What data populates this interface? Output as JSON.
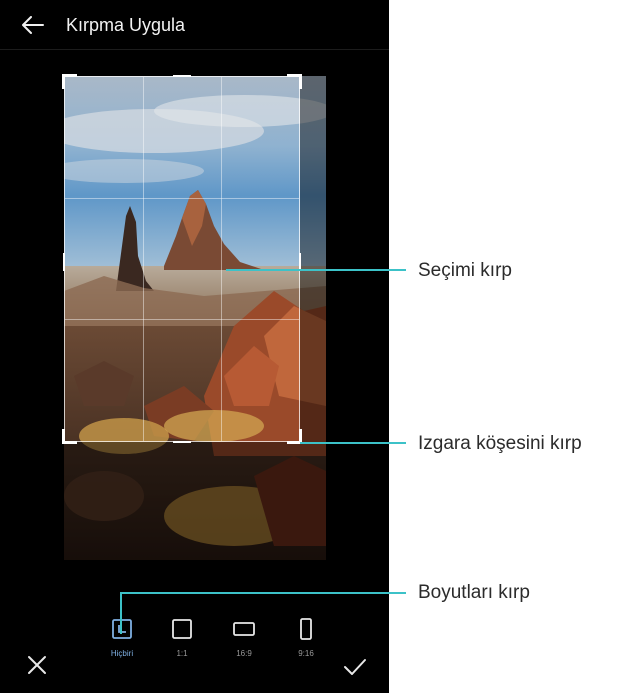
{
  "appbar": {
    "title": "Kırpma Uygula",
    "back_icon": "arrow-left-icon"
  },
  "image": {
    "description_icon": "landscape-photo",
    "subject": "desert rock formation at sunset"
  },
  "aspect_options": [
    {
      "label": "Hiçbiri",
      "icon": "freeform-crop-icon",
      "selected": true
    },
    {
      "label": "1:1",
      "icon": "square-icon",
      "selected": false
    },
    {
      "label": "16:9",
      "icon": "landscape-rect-icon",
      "selected": false
    },
    {
      "label": "9:16",
      "icon": "portrait-rect-icon",
      "selected": false
    }
  ],
  "actions": {
    "cancel_icon": "close-icon",
    "confirm_icon": "check-icon"
  },
  "callouts": {
    "crop_selection": "Seçimi kırp",
    "crop_grid_corner": "Izgara köşesini kırp",
    "crop_dimensions": "Boyutları kırp"
  },
  "colors": {
    "callout": "#3cc2c8",
    "selected": "#7fb0e3",
    "background": "#000000"
  }
}
